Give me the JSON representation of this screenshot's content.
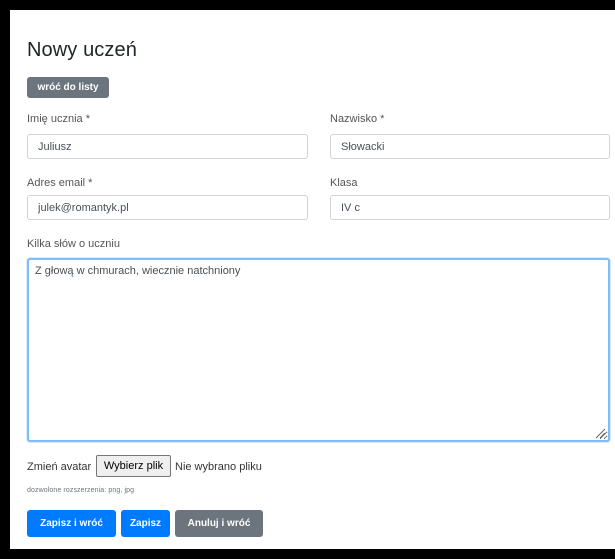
{
  "page": {
    "title": "Nowy uczeń",
    "back_button": "wróć do listy"
  },
  "form": {
    "first_name": {
      "label": "Imię ucznia *",
      "value": "Juliusz"
    },
    "last_name": {
      "label": "Nazwisko *",
      "value": "Słowacki"
    },
    "email": {
      "label": "Adres email *",
      "value": "julek@romantyk.pl"
    },
    "class": {
      "label": "Klasa",
      "value": "IV c"
    },
    "about": {
      "label": "Kilka słów o uczniu",
      "value": "Z głową w chmurach, wiecznie natchniony"
    },
    "avatar": {
      "label": "Zmień avatar",
      "button": "Wybierz plik",
      "status": "Nie wybrano pliku",
      "hint": "dozwolone rozszerzenia: png, jpg"
    }
  },
  "actions": {
    "save_and_return": "Zapisz i wróć",
    "save": "Zapisz",
    "cancel_and_return": "Anuluj i wróć"
  },
  "colors": {
    "primary": "#007bff",
    "secondary": "#6c757d",
    "focus_border": "#80bdff"
  }
}
